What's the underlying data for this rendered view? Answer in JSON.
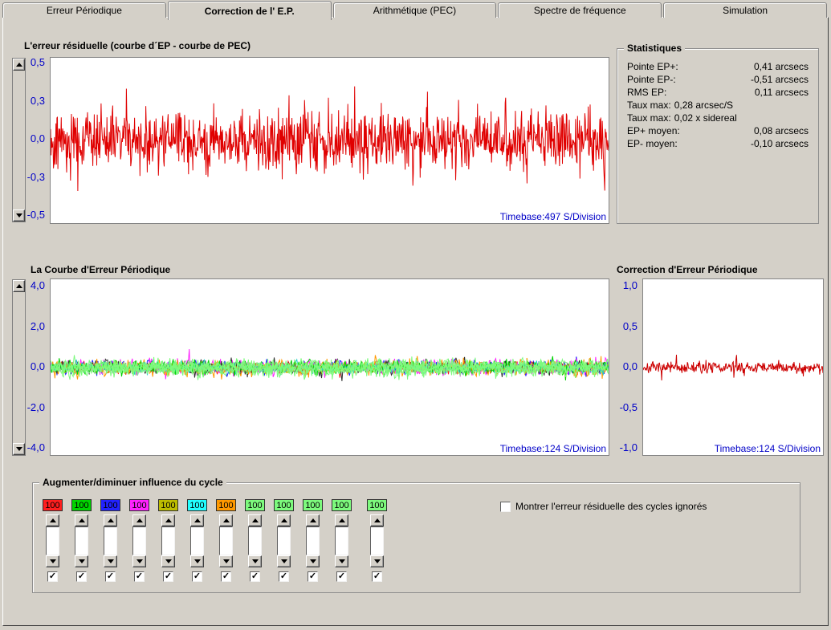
{
  "tabs": [
    {
      "label": "Erreur Périodique",
      "active": false
    },
    {
      "label": "Correction de l' E.P.",
      "active": true
    },
    {
      "label": "Arithmétique (PEC)",
      "active": false
    },
    {
      "label": "Spectre de fréquence",
      "active": false
    },
    {
      "label": "Simulation",
      "active": false
    }
  ],
  "residual_chart": {
    "title": "L'erreur résiduelle (courbe d´EP - courbe de PEC)",
    "y_ticks": [
      "0,5",
      "0,3",
      "0,0",
      "-0,3",
      "-0,5"
    ],
    "timebase": "Timebase:497 S/Division",
    "line_color": "#e00000"
  },
  "statistics": {
    "title": "Statistiques",
    "rows": [
      {
        "label": "Pointe EP+:",
        "value": "0,41 arcsecs"
      },
      {
        "label": "Pointe EP-:",
        "value": "-0,51 arcsecs"
      },
      {
        "label": "RMS EP:",
        "value": "0,11 arcsecs"
      },
      {
        "label": "Taux max:",
        "value": "0,28 arcsec/S"
      },
      {
        "label": "Taux max:",
        "value": "0,02 x sidereal"
      },
      {
        "label": "EP+ moyen:",
        "value": "0,08 arcsecs"
      },
      {
        "label": "EP- moyen:",
        "value": "-0,10 arcsecs"
      }
    ]
  },
  "pe_chart": {
    "title": "La Courbe d'Erreur Périodique",
    "y_ticks": [
      "4,0",
      "2,0",
      "0,0",
      "-2,0",
      "-4,0"
    ],
    "timebase": "Timebase:124 S/Division",
    "series_colors": [
      "#ff1f1f",
      "#2222ff",
      "#ff22ff",
      "#bdbd00",
      "#303030",
      "#ff9900",
      "#22cccc",
      "#00d400",
      "#7dfa7d",
      "#7dfa7d",
      "#7dfa7d",
      "#7dfa7d"
    ]
  },
  "pec_chart": {
    "title": "Correction d'Erreur Périodique",
    "y_ticks": [
      "1,0",
      "0,5",
      "0,0",
      "-0,5",
      "-1,0"
    ],
    "timebase": "Timebase:124 S/Division",
    "line_color": "#cc0000"
  },
  "cycle_panel": {
    "title": "Augmenter/diminuer influence du cycle",
    "sliders": [
      {
        "value": "100",
        "color": "#ff1f1f",
        "checked": true
      },
      {
        "value": "100",
        "color": "#00d400",
        "checked": true
      },
      {
        "value": "100",
        "color": "#2222ff",
        "checked": true
      },
      {
        "value": "100",
        "color": "#ff22ff",
        "checked": true
      },
      {
        "value": "100",
        "color": "#bdbd00",
        "checked": true
      },
      {
        "value": "100",
        "color": "#22ffff",
        "checked": true
      },
      {
        "value": "100",
        "color": "#ff9900",
        "checked": true
      },
      {
        "value": "100",
        "color": "#7dfa7d",
        "checked": true
      },
      {
        "value": "100",
        "color": "#7dfa7d",
        "checked": true
      },
      {
        "value": "100",
        "color": "#7dfa7d",
        "checked": true
      },
      {
        "value": "100",
        "color": "#7dfa7d",
        "checked": true
      },
      {
        "value": "100",
        "color": "#7dfa7d",
        "checked": true
      }
    ],
    "checkbox_label": "Montrer l'erreur résiduelle des cycles ignorés",
    "checkbox_checked": false
  }
}
